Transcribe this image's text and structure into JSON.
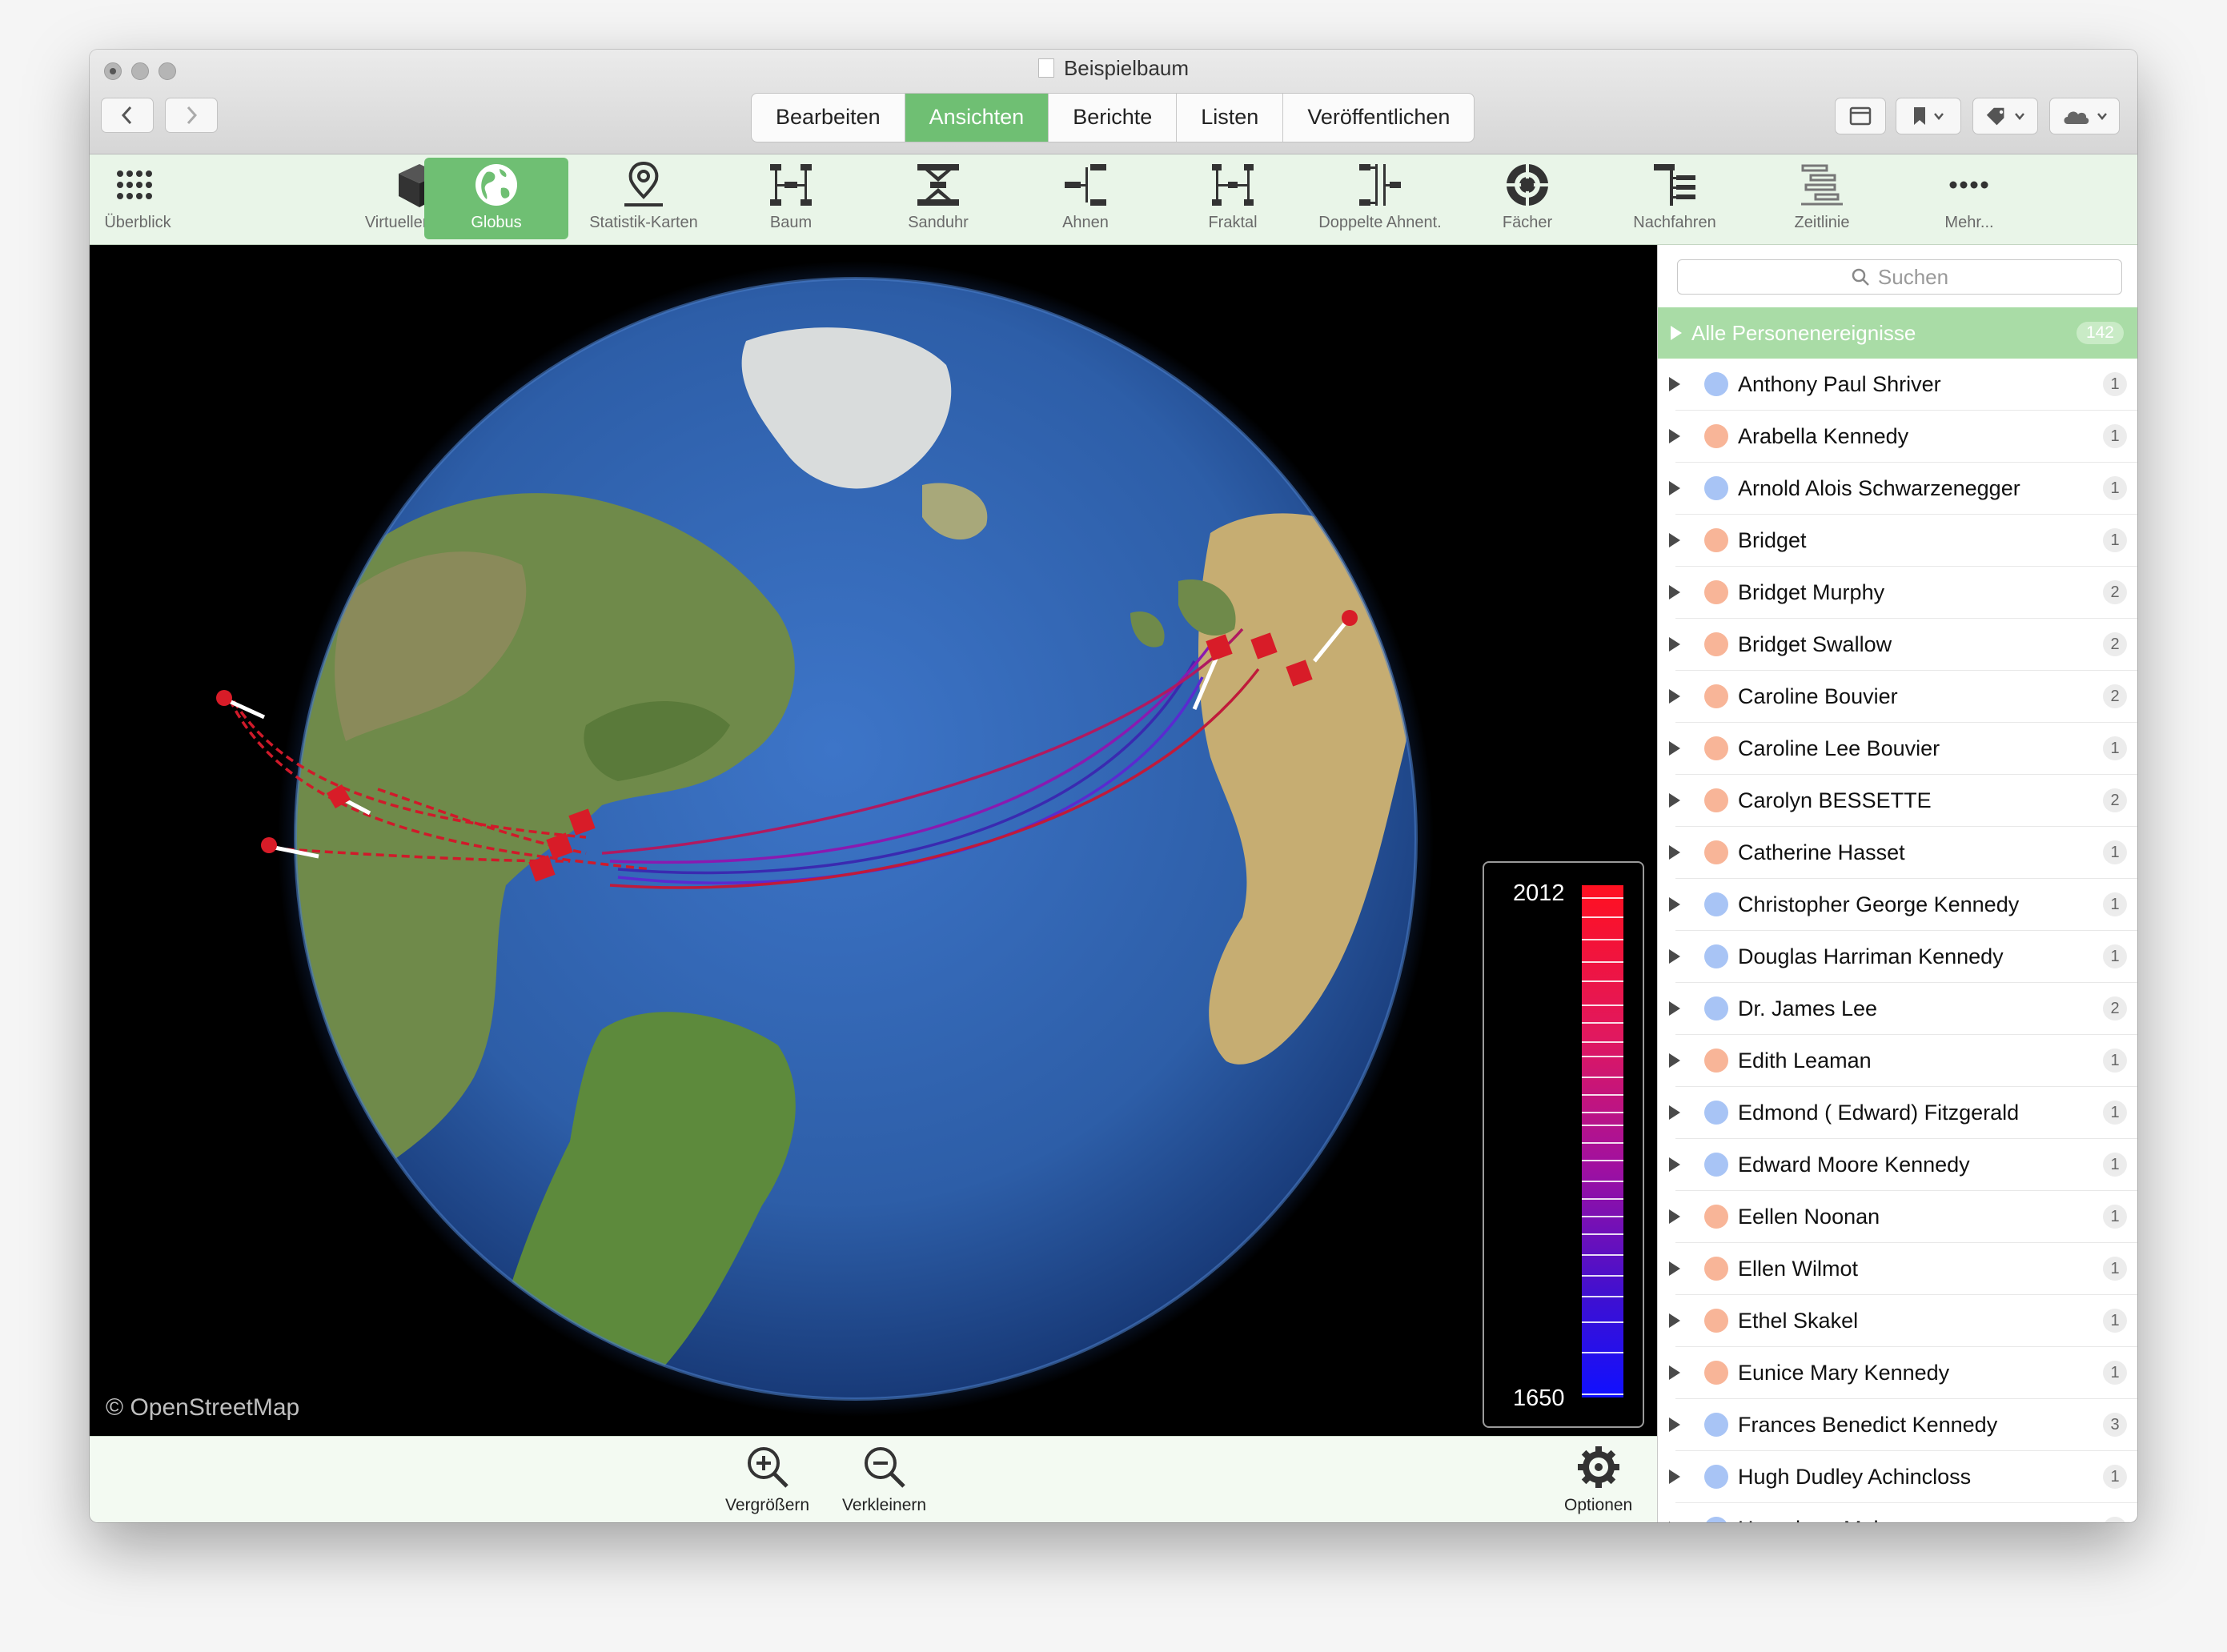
{
  "window": {
    "title": "Beispielbaum"
  },
  "segments": [
    {
      "label": "Bearbeiten",
      "active": false
    },
    {
      "label": "Ansichten",
      "active": true
    },
    {
      "label": "Berichte",
      "active": false
    },
    {
      "label": "Listen",
      "active": false
    },
    {
      "label": "Veröffentlichen",
      "active": false
    }
  ],
  "toolbar": {
    "items": [
      {
        "label": "Überblick",
        "icon": "grid-icon"
      },
      {
        "label": "Virtueller Baum",
        "icon": "cube-icon"
      },
      {
        "label": "Globus",
        "icon": "globe-icon",
        "active": true
      },
      {
        "label": "Statistik-Karten",
        "icon": "map-pin-icon"
      },
      {
        "label": "Baum",
        "icon": "tree-icon"
      },
      {
        "label": "Sanduhr",
        "icon": "hourglass-icon"
      },
      {
        "label": "Ahnen",
        "icon": "ancestors-icon"
      },
      {
        "label": "Fraktal",
        "icon": "fractal-icon"
      },
      {
        "label": "Doppelte Ahnent.",
        "icon": "double-ancestors-icon"
      },
      {
        "label": "Fächer",
        "icon": "fan-icon"
      },
      {
        "label": "Nachfahren",
        "icon": "descendants-icon"
      },
      {
        "label": "Zeitlinie",
        "icon": "timeline-icon"
      },
      {
        "label": "Mehr...",
        "icon": "more-icon"
      }
    ]
  },
  "map": {
    "attribution": "© OpenStreetMap"
  },
  "legend": {
    "max": "2012",
    "min": "1650"
  },
  "bottom": {
    "zoom_in": "Vergrößern",
    "zoom_out": "Verkleinern",
    "options": "Optionen"
  },
  "sidebar": {
    "search_placeholder": "Suchen",
    "all": {
      "label": "Alle Personenereignisse",
      "count": "142"
    },
    "persons": [
      {
        "name": "Anthony Paul Shriver",
        "count": "1",
        "color": "#a8c4f5"
      },
      {
        "name": "Arabella Kennedy",
        "count": "1",
        "color": "#f8b598"
      },
      {
        "name": "Arnold Alois Schwarzenegger",
        "count": "1",
        "color": "#a8c4f5"
      },
      {
        "name": "Bridget",
        "count": "1",
        "color": "#f8b598"
      },
      {
        "name": "Bridget Murphy",
        "count": "2",
        "color": "#f8b598"
      },
      {
        "name": "Bridget Swallow",
        "count": "2",
        "color": "#f8b598"
      },
      {
        "name": "Caroline Bouvier",
        "count": "2",
        "color": "#f8b598"
      },
      {
        "name": "Caroline Lee Bouvier",
        "count": "1",
        "color": "#f8b598"
      },
      {
        "name": "Carolyn BESSETTE",
        "count": "2",
        "color": "#f8b598"
      },
      {
        "name": "Catherine Hasset",
        "count": "1",
        "color": "#f8b598"
      },
      {
        "name": "Christopher George Kennedy",
        "count": "1",
        "color": "#a8c4f5"
      },
      {
        "name": "Douglas Harriman Kennedy",
        "count": "1",
        "color": "#a8c4f5"
      },
      {
        "name": "Dr. James Lee",
        "count": "2",
        "color": "#a8c4f5"
      },
      {
        "name": "Edith Leaman",
        "count": "1",
        "color": "#f8b598"
      },
      {
        "name": "Edmond ( Edward) Fitzgerald",
        "count": "1",
        "color": "#a8c4f5"
      },
      {
        "name": "Edward Moore Kennedy",
        "count": "1",
        "color": "#a8c4f5"
      },
      {
        "name": "Eellen Noonan",
        "count": "1",
        "color": "#f8b598"
      },
      {
        "name": "Ellen Wilmot",
        "count": "1",
        "color": "#f8b598"
      },
      {
        "name": "Ethel Skakel",
        "count": "1",
        "color": "#f8b598"
      },
      {
        "name": "Eunice Mary Kennedy",
        "count": "1",
        "color": "#f8b598"
      },
      {
        "name": "Frances Benedict Kennedy",
        "count": "3",
        "color": "#a8c4f5"
      },
      {
        "name": "Hugh Dudley Achincloss",
        "count": "1",
        "color": "#a8c4f5"
      },
      {
        "name": "Humphrey Mahoney",
        "count": "1",
        "color": "#a8c4f5"
      }
    ]
  }
}
